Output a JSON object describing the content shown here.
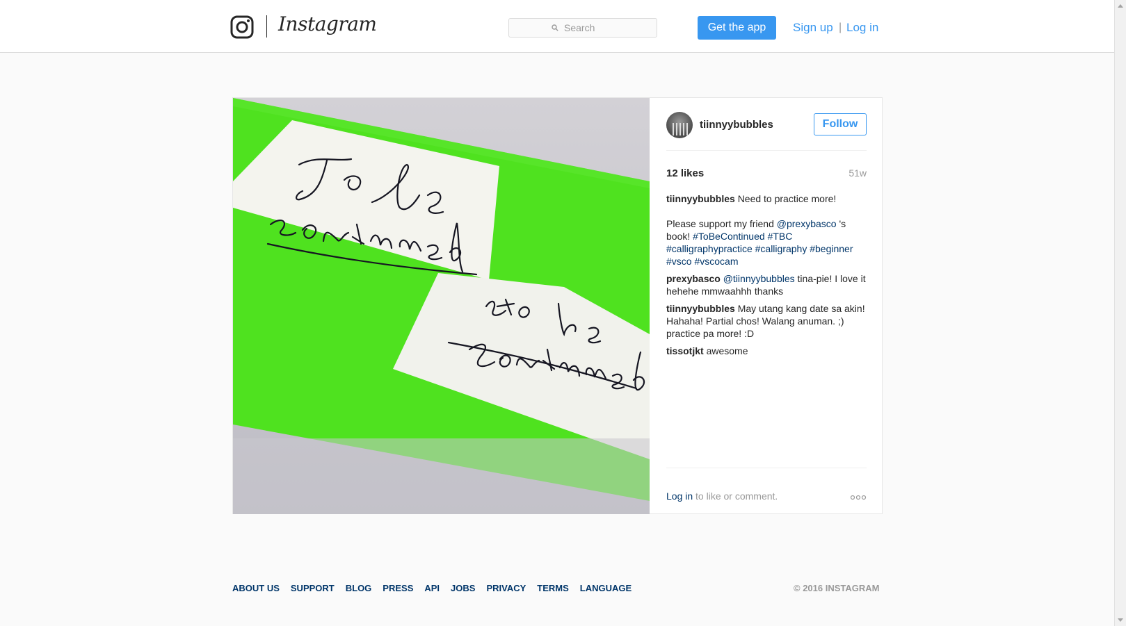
{
  "header": {
    "wordmark": "Instagram",
    "search": {
      "placeholder": "Search"
    },
    "get_app_label": "Get the app",
    "signup_label": "Sign up",
    "separator": "|",
    "login_label": "Log in"
  },
  "post": {
    "image_text": [
      "To be continued",
      "to be continued"
    ],
    "author": "tiinnyybubbles",
    "follow_label": "Follow",
    "likes": "12 likes",
    "age": "51w",
    "caption": {
      "user": "tiinnyybubbles",
      "text": "Need to practice more!",
      "line2_prefix": "Please support my friend ",
      "mention": "@prexybasco",
      "line2_suffix": " 's book! ",
      "hashtags": [
        "#ToBeContinued",
        "#TBC",
        "#calligraphypractice",
        "#calligraphy",
        "#beginner",
        "#vsco",
        "#vscocam"
      ]
    },
    "comments": [
      {
        "user": "prexybasco",
        "mention": "@tiinnyybubbles",
        "text": " tina-pie! I love it hehehe mmwaahhh thanks"
      },
      {
        "user": "tiinnyybubbles",
        "mention": "",
        "text": "May utang kang date sa akin! Hahaha! Partial chos! Walang anuman. ;) practice pa more! :D"
      },
      {
        "user": "tissotjkt",
        "mention": "",
        "text": "awesome"
      }
    ],
    "login_link": "Log in",
    "login_suffix": " to like or comment."
  },
  "footer": {
    "links": [
      "ABOUT US",
      "SUPPORT",
      "BLOG",
      "PRESS",
      "API",
      "JOBS",
      "PRIVACY",
      "TERMS",
      "LANGUAGE"
    ],
    "copyright": "© 2016 INSTAGRAM"
  },
  "colors": {
    "accent": "#3897f0",
    "link": "#003569",
    "photo_green": "#4fe21f"
  },
  "icons": [
    "instagram-camera-icon",
    "search-icon",
    "more-options-icon"
  ]
}
